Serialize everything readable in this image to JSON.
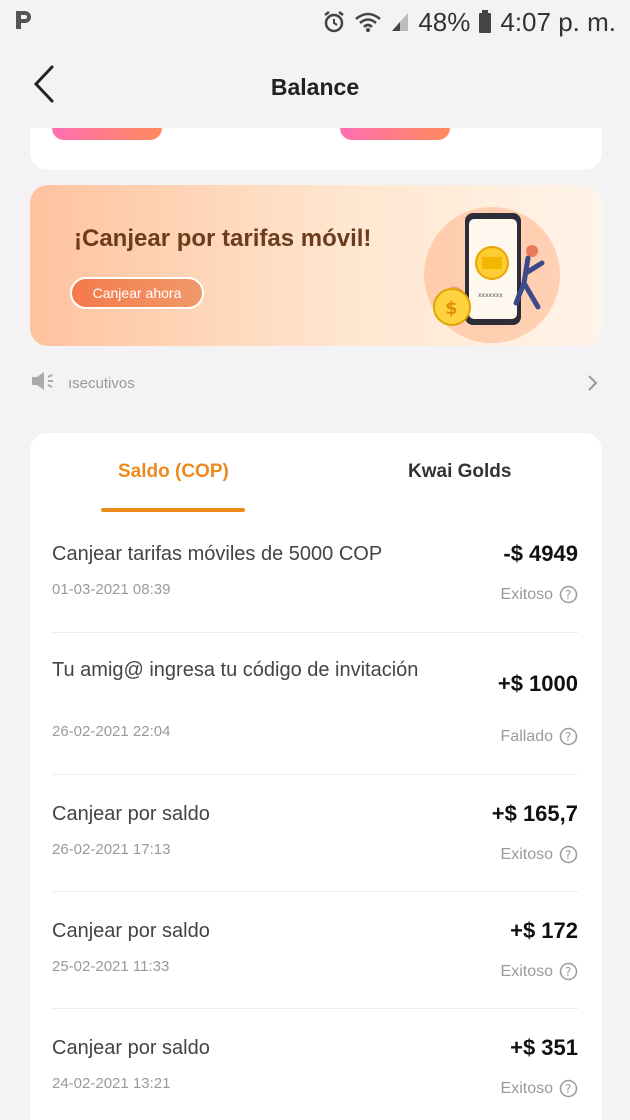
{
  "status_bar": {
    "battery": "48%",
    "time": "4:07 p. m."
  },
  "header": {
    "title": "Balance"
  },
  "promo": {
    "title": "¡Canjear por tarifas móvil!",
    "button": "Canjear ahora"
  },
  "marquee": {
    "text": "ısecutivos"
  },
  "tabs": [
    {
      "label": "Saldo (COP)",
      "active": true
    },
    {
      "label": "Kwai Golds",
      "active": false
    }
  ],
  "transactions": [
    {
      "title": "Canjear tarifas móviles de 5000 COP",
      "date": "01-03-2021 08:39",
      "amount": "-$ 4949",
      "status": "Exitoso"
    },
    {
      "title": "Tu amig@ ingresa tu código de invitación",
      "date": "26-02-2021 22:04",
      "amount": "+$ 1000",
      "status": "Fallado"
    },
    {
      "title": "Canjear por saldo",
      "date": "26-02-2021 17:13",
      "amount": "+$ 165,7",
      "status": "Exitoso"
    },
    {
      "title": "Canjear por saldo",
      "date": "25-02-2021 11:33",
      "amount": "+$ 172",
      "status": "Exitoso"
    },
    {
      "title": "Canjear por saldo",
      "date": "24-02-2021 13:21",
      "amount": "+$ 351",
      "status": "Exitoso"
    }
  ],
  "colors": {
    "accent": "#ee8a1d",
    "promo_button": "#f57a4a",
    "pink": "#ff6fb1"
  }
}
